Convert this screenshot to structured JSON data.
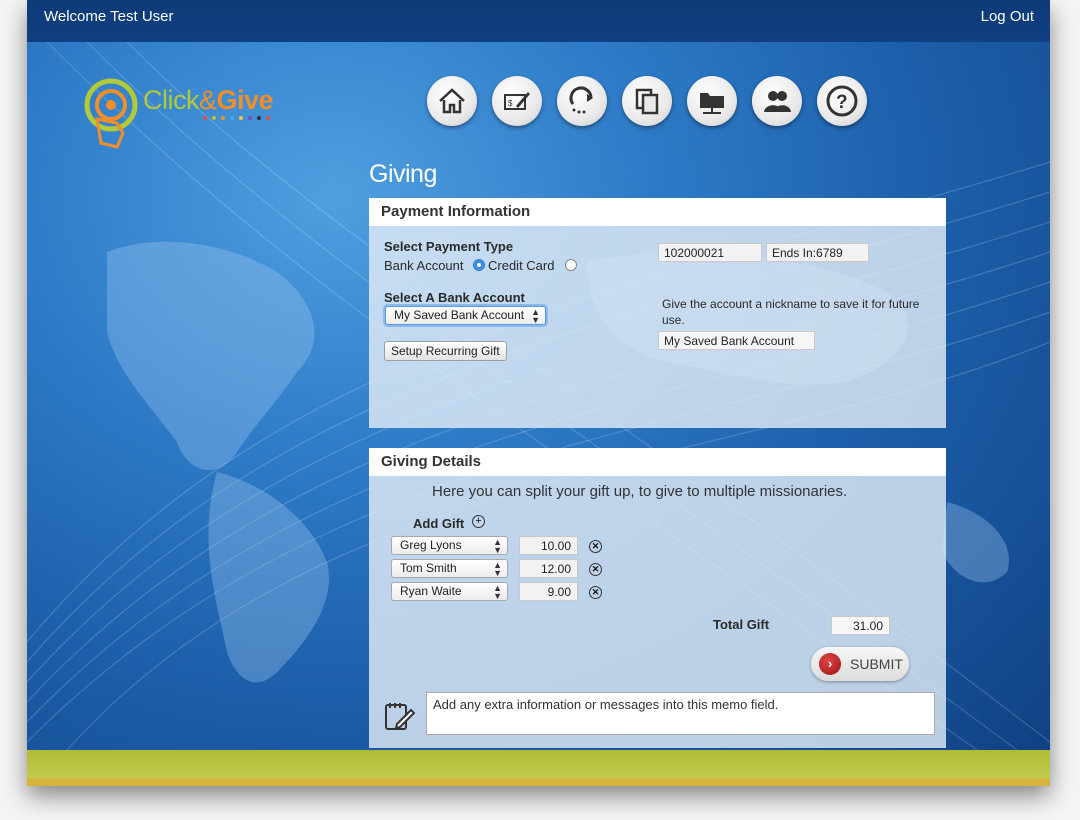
{
  "header": {
    "welcome": "Welcome Test User",
    "logout": "Log Out"
  },
  "logo": {
    "part1": "Click",
    "amp": "&",
    "part2": "Give"
  },
  "nav": {
    "icons": [
      "home-icon",
      "edit-payment-icon",
      "refresh-icon",
      "copy-icon",
      "folder-network-icon",
      "users-icon",
      "help-icon"
    ]
  },
  "page_title": "Giving",
  "payment": {
    "title": "Payment Information",
    "select_type_label": "Select Payment Type",
    "option_bank": "Bank Account",
    "option_card": "Credit Card",
    "selected": "Bank Account",
    "account_number": "102000021",
    "ends_in": "Ends In:6789",
    "select_bank_label": "Select A Bank Account",
    "bank_selected": "My Saved Bank Account",
    "nickname_hint": "Give the account a nickname to save it for future use.",
    "nickname_value": "My Saved Bank Account",
    "recurring_button": "Setup Recurring Gift"
  },
  "giving": {
    "title": "Giving Details",
    "intro": "Here you can split your gift up, to give to multiple missionaries.",
    "add_gift_label": "Add Gift",
    "gifts": [
      {
        "name": "Greg Lyons",
        "amount": "10.00"
      },
      {
        "name": "Tom Smith",
        "amount": "12.00"
      },
      {
        "name": "Ryan Waite",
        "amount": "9.00"
      }
    ],
    "total_label": "Total Gift",
    "total_value": "31.00",
    "submit_label": "SUBMIT",
    "memo_text": "Add any extra information or messages into this memo field."
  },
  "colors": {
    "topbar": "#0d3a78",
    "background": "#1c5ea9",
    "band": "#aebc35",
    "logo_green": "#b2c93a",
    "logo_orange": "#f08f2a",
    "submit_red": "#b81c1c"
  }
}
